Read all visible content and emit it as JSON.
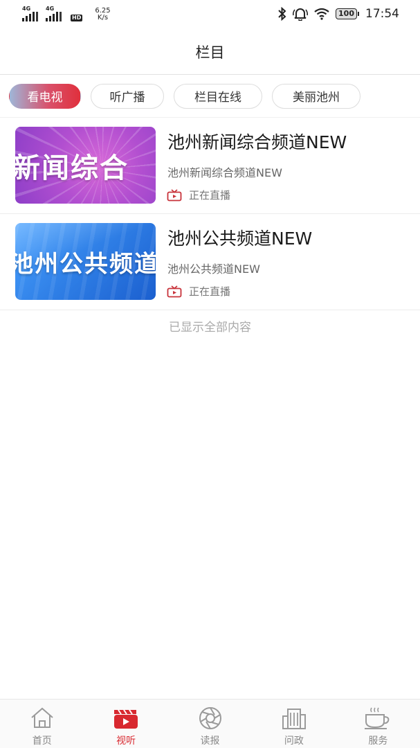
{
  "status_bar": {
    "network_1": "4G",
    "network_2": "4G",
    "hd_badge": "HD",
    "speed_value": "6.25",
    "speed_unit": "K/s",
    "battery": "100",
    "time": "17:54"
  },
  "header": {
    "title": "栏目"
  },
  "tabs": [
    {
      "label": "看电视",
      "active": true
    },
    {
      "label": "听广播",
      "active": false
    },
    {
      "label": "栏目在线",
      "active": false
    },
    {
      "label": "美丽池州",
      "active": false
    }
  ],
  "channels": [
    {
      "title": "池州新闻综合频道NEW",
      "subtitle": "池州新闻综合频道NEW",
      "thumb_text": "新闻综合",
      "live_status": "正在直播"
    },
    {
      "title": "池州公共频道NEW",
      "subtitle": "池州公共频道NEW",
      "thumb_text": "池州公共频道",
      "live_status": "正在直播"
    }
  ],
  "end_note": "已显示全部内容",
  "bottom_nav": [
    {
      "label": "首页",
      "icon": "home-icon",
      "active": false
    },
    {
      "label": "视听",
      "icon": "clapperboard-icon",
      "active": true
    },
    {
      "label": "读报",
      "icon": "aperture-icon",
      "active": false
    },
    {
      "label": "问政",
      "icon": "building-icon",
      "active": false
    },
    {
      "label": "服务",
      "icon": "coffee-cup-icon",
      "active": false
    }
  ],
  "colors": {
    "accent": "#d8282f",
    "live_icon": "#c8323a"
  }
}
